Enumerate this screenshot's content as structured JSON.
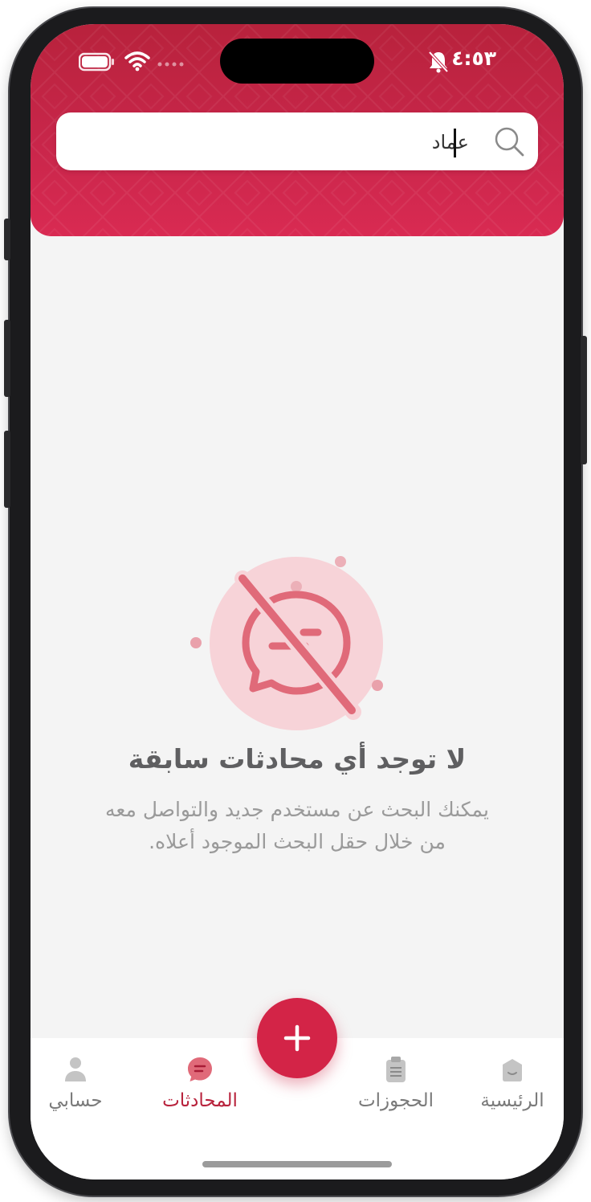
{
  "status_bar": {
    "time": "٤:٥٣"
  },
  "search": {
    "value": "عماد"
  },
  "empty_state": {
    "title": "لا توجد أي محادثات سابقة",
    "description_line1": "يمكنك البحث عن مستخدم جديد والتواصل معه",
    "description_line2": "من خلال حقل البحث الموجود أعلاه."
  },
  "tabs": [
    {
      "label": "الرئيسية",
      "icon": "home-icon",
      "active": false
    },
    {
      "label": "الحجوزات",
      "icon": "clipboard-icon",
      "active": false
    },
    {
      "label": "المحادثات",
      "icon": "chat-icon",
      "active": true
    },
    {
      "label": "حسابي",
      "icon": "user-icon",
      "active": false
    }
  ],
  "fab": {
    "icon": "plus-icon"
  },
  "colors": {
    "brand": "#c8264a",
    "brand_dark": "#b8223c",
    "illustration_bg": "#f7d3d8",
    "illustration_stroke": "#e06a79",
    "inactive_tab": "#7a7a7a"
  }
}
